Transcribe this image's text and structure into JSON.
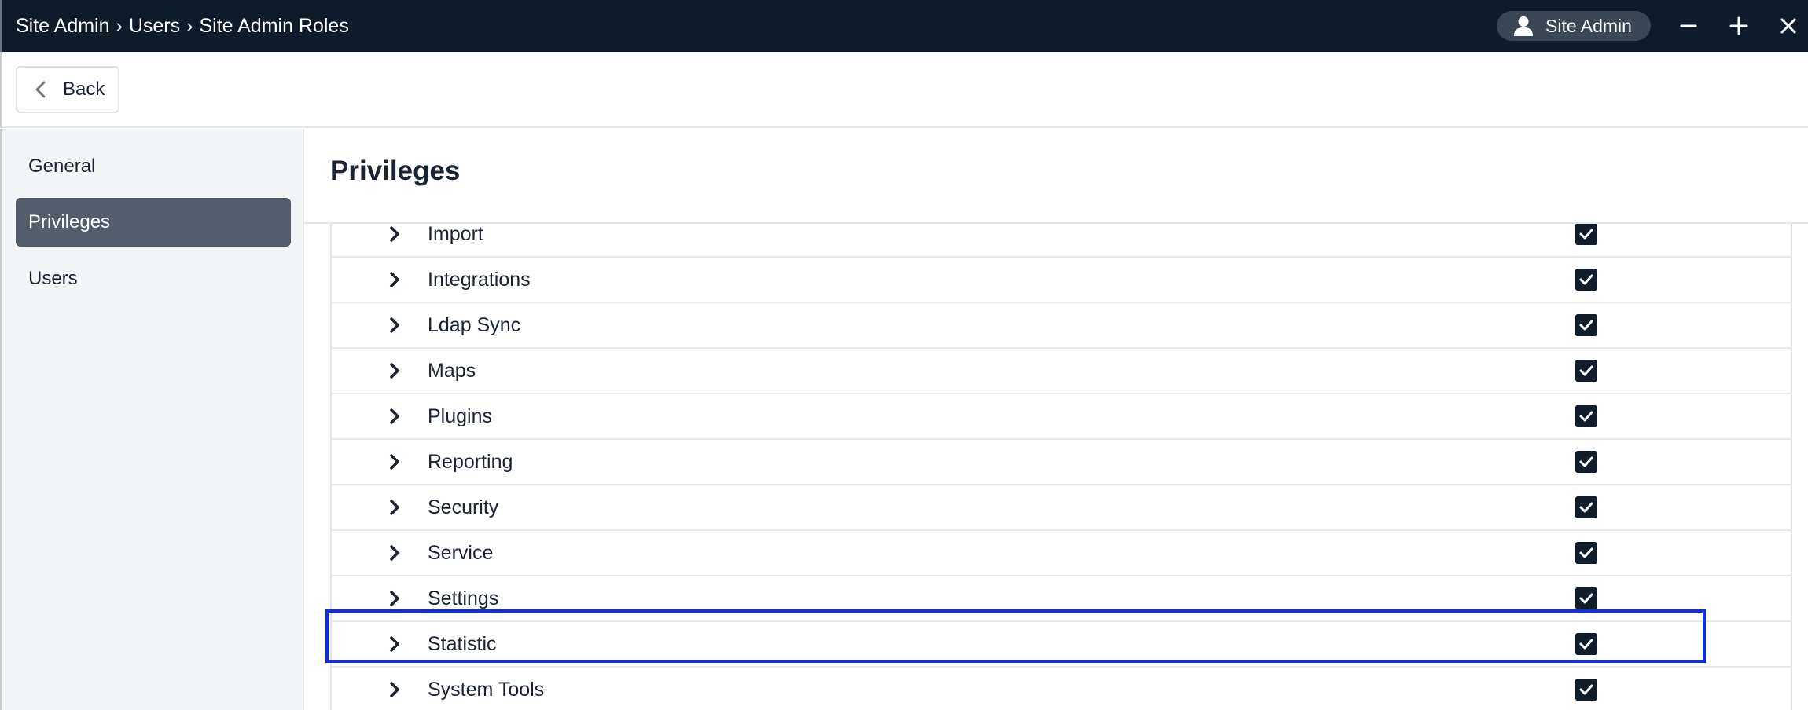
{
  "header": {
    "breadcrumb": [
      "Site Admin",
      "Users",
      "Site Admin Roles"
    ],
    "separator": "›",
    "user_label": "Site Admin"
  },
  "back_label": "Back",
  "sidebar": {
    "items": [
      {
        "label": "General",
        "active": false
      },
      {
        "label": "Privileges",
        "active": true
      },
      {
        "label": "Users",
        "active": false
      }
    ]
  },
  "main": {
    "title": "Privileges",
    "privileges": [
      {
        "label": "Import",
        "checked": true
      },
      {
        "label": "Integrations",
        "checked": true
      },
      {
        "label": "Ldap Sync",
        "checked": true
      },
      {
        "label": "Maps",
        "checked": true
      },
      {
        "label": "Plugins",
        "checked": true
      },
      {
        "label": "Reporting",
        "checked": true
      },
      {
        "label": "Security",
        "checked": true
      },
      {
        "label": "Service",
        "checked": true
      },
      {
        "label": "Settings",
        "checked": true
      },
      {
        "label": "Statistic",
        "checked": true
      },
      {
        "label": "System Tools",
        "checked": true
      }
    ]
  },
  "colors": {
    "header_bg": "#0d1b2a",
    "active_nav_bg": "#545d6b",
    "checkbox": "#111d2b",
    "highlight": "#1030d8"
  }
}
